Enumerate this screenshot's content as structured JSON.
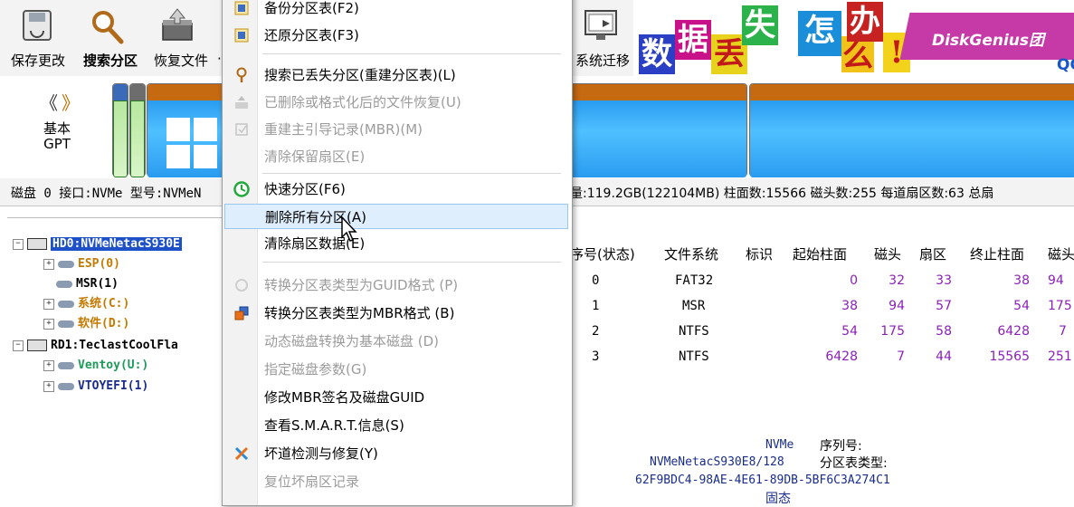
{
  "toolbar": {
    "buttons": [
      {
        "label": "保存更改",
        "icon": "save-disk-icon"
      },
      {
        "label": "搜索分区",
        "icon": "magnifier-icon"
      },
      {
        "label": "恢复文件",
        "icon": "restore-box-icon"
      },
      {
        "label": "系统迁移",
        "icon": "system-migrate-icon"
      }
    ],
    "more_marker": "·"
  },
  "banner": {
    "chars": [
      "数",
      "据",
      "丢",
      "失",
      "怎",
      "么",
      "办",
      "!"
    ],
    "brand": "DiskGenius团",
    "qq_fragment": "QC"
  },
  "diskmap": {
    "nav_left": "《",
    "nav_right": "》",
    "disk_type_line1": "基本",
    "disk_type_line2": "GPT"
  },
  "diskinfo": {
    "left": "磁盘 0 接口:NVMe  型号:NVMeN",
    "right": "量:119.2GB(122104MB)  柱面数:15566  磁头数:255  每道扇区数:63  总扇"
  },
  "tree": {
    "disk0": "HD0:NVMeNetacS930E",
    "partitions0": [
      {
        "label": "ESP(0)",
        "color": "#c47a00",
        "expandable": true
      },
      {
        "label": "MSR(1)",
        "color": "#000000",
        "expandable": false
      },
      {
        "label": "系统(C:)",
        "color": "#c47a00",
        "expandable": true
      },
      {
        "label": "软件(D:)",
        "color": "#c47a00",
        "expandable": true
      }
    ],
    "disk1": "RD1:TeclastCoolFla",
    "partitions1": [
      {
        "label": "Ventoy(U:)",
        "color": "#1e9a5a",
        "expandable": true
      },
      {
        "label": "VTOYEFI(1)",
        "color": "#1a2d8c",
        "expandable": true
      }
    ]
  },
  "table": {
    "headers": [
      "序号(状态)",
      "文件系统",
      "标识",
      "起始柱面",
      "磁头",
      "扇区",
      "终止柱面",
      "磁头"
    ],
    "rows": [
      {
        "index": "0",
        "fs": "FAT32",
        "start_cyl": "0",
        "head": "32",
        "sector": "33",
        "end_cyl": "38",
        "end_head": "94"
      },
      {
        "index": "1",
        "fs": "MSR",
        "start_cyl": "38",
        "head": "94",
        "sector": "57",
        "end_cyl": "54",
        "end_head": "175"
      },
      {
        "index": "2",
        "fs": "NTFS",
        "start_cyl": "54",
        "head": "175",
        "sector": "58",
        "end_cyl": "6428",
        "end_head": "7"
      },
      {
        "index": "3",
        "fs": "NTFS",
        "start_cyl": "6428",
        "head": "7",
        "sector": "44",
        "end_cyl": "15565",
        "end_head": "251"
      }
    ]
  },
  "details": {
    "interface": "NVMe",
    "serial_label": "序列号:",
    "model": "NVMeNetacS930E8/128",
    "ptype_label": "分区表类型:",
    "guid": "62F9BDC4-98AE-4E61-89DB-5BF6C3A274C1",
    "media": "固态"
  },
  "menu": {
    "items": [
      {
        "label": "备份分区表(F2)",
        "disabled": false,
        "icon": "backup-table-icon"
      },
      {
        "label": "还原分区表(F3)",
        "disabled": false,
        "icon": "restore-table-icon"
      },
      {
        "label": "搜索已丢失分区(重建分区表)(L)",
        "disabled": false,
        "icon": "search-lost-partition-icon"
      },
      {
        "label": "已删除或格式化后的文件恢复(U)",
        "disabled": true,
        "icon": "file-recovery-icon"
      },
      {
        "label": "重建主引导记录(MBR)(M)",
        "disabled": true,
        "icon": "rebuild-mbr-icon"
      },
      {
        "label": "清除保留扇区(E)",
        "disabled": true,
        "icon": ""
      },
      {
        "label": "快速分区(F6)",
        "disabled": false,
        "icon": "quick-partition-icon"
      },
      {
        "label": "删除所有分区(A)",
        "disabled": false,
        "icon": ""
      },
      {
        "label": "清除扇区数据(E)",
        "disabled": false,
        "icon": ""
      },
      {
        "label": "转换分区表类型为GUID格式 (P)",
        "disabled": true,
        "icon": "convert-guid-icon"
      },
      {
        "label": "转换分区表类型为MBR格式 (B)",
        "disabled": false,
        "icon": "convert-mbr-icon"
      },
      {
        "label": "动态磁盘转换为基本磁盘 (D)",
        "disabled": true,
        "icon": ""
      },
      {
        "label": "指定磁盘参数(G)",
        "disabled": true,
        "icon": ""
      },
      {
        "label": "修改MBR签名及磁盘GUID",
        "disabled": false,
        "icon": ""
      },
      {
        "label": "查看S.M.A.R.T.信息(S)",
        "disabled": false,
        "icon": ""
      },
      {
        "label": "坏道检测与修复(Y)",
        "disabled": false,
        "icon": "bad-sector-tools-icon"
      },
      {
        "label": "复位坏扇区记录",
        "disabled": true,
        "icon": ""
      }
    ]
  }
}
